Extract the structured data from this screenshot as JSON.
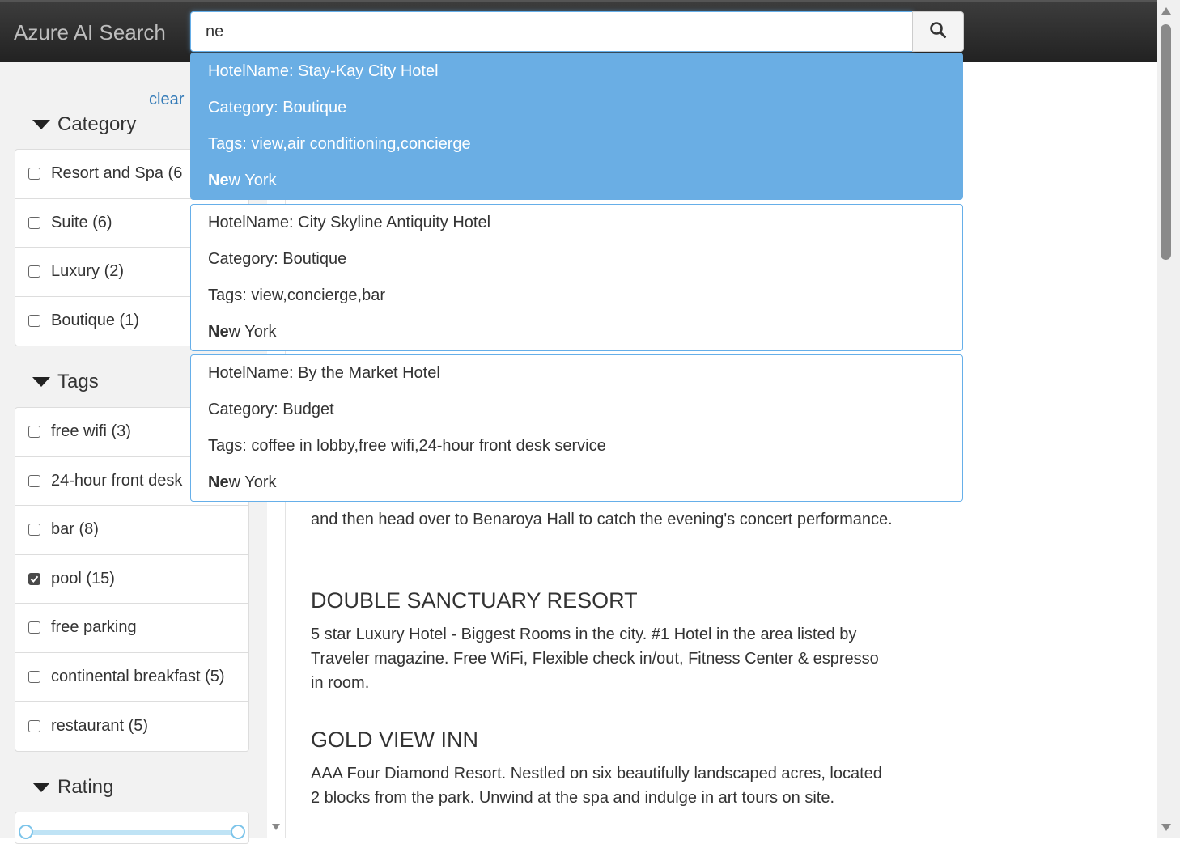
{
  "header": {
    "brand": "Azure AI Search",
    "search_value": "ne",
    "search_icon": "search-icon"
  },
  "sidebar": {
    "clear_label": "clear",
    "category": {
      "title": "Category",
      "items": [
        {
          "label": "Resort and Spa (6",
          "checked": false
        },
        {
          "label": "Suite (6)",
          "checked": false
        },
        {
          "label": "Luxury (2)",
          "checked": false
        },
        {
          "label": "Boutique (1)",
          "checked": false
        }
      ]
    },
    "tags": {
      "title": "Tags",
      "items": [
        {
          "label": "free wifi (3)",
          "checked": false
        },
        {
          "label": "24-hour front desk",
          "checked": false
        },
        {
          "label": "bar (8)",
          "checked": false
        },
        {
          "label": "pool (15)",
          "checked": true
        },
        {
          "label": "free parking",
          "checked": false
        },
        {
          "label": "continental breakfast (5)",
          "checked": false
        },
        {
          "label": "restaurant (5)",
          "checked": false
        }
      ]
    },
    "rating": {
      "title": "Rating"
    }
  },
  "suggestions": [
    {
      "name": "HotelName: Stay-Kay City Hotel",
      "category": "Category: Boutique",
      "tags": "Tags: view,air conditioning,concierge",
      "city_match": "Ne",
      "city_rest": "w York",
      "active": true
    },
    {
      "name": "HotelName: City Skyline Antiquity Hotel",
      "category": "Category: Boutique",
      "tags": "Tags: view,concierge,bar",
      "city_match": "Ne",
      "city_rest": "w York",
      "active": false
    },
    {
      "name": "HotelName: By the Market Hotel",
      "category": "Category: Budget",
      "tags": "Tags: coffee in lobby,free wifi,24-hour front desk service",
      "city_match": "Ne",
      "city_rest": "w York",
      "active": false
    }
  ],
  "results": {
    "partial_description": "and then head over to Benaroya Hall to catch the evening's concert performance.",
    "items": [
      {
        "title": "DOUBLE SANCTUARY RESORT",
        "description": "5 star Luxury Hotel - Biggest Rooms in the city. #1 Hotel in the area listed by Traveler magazine. Free WiFi, Flexible check in/out, Fitness Center & espresso in room."
      },
      {
        "title": "GOLD VIEW INN",
        "description": "AAA Four Diamond Resort. Nestled on six beautifully landscaped acres, located 2 blocks from the park. Unwind at the spa and indulge in art tours on site."
      }
    ]
  },
  "colors": {
    "accent": "#66afe9",
    "active_suggestion": "#6aaee4",
    "link": "#337ab7"
  }
}
